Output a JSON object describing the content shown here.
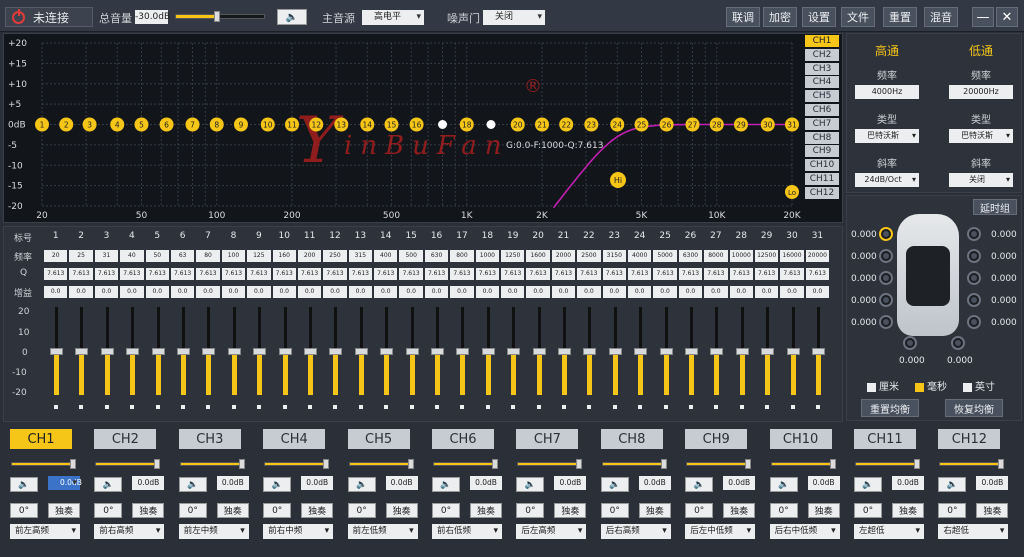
{
  "topbar": {
    "connection_label": "未连接",
    "master_volume_label": "总音量",
    "master_volume_value": "-30.0dB",
    "master_volume_level": 0.45,
    "main_source_label": "主音源",
    "main_source_value": "高电平",
    "noise_gate_label": "噪声门",
    "noise_gate_value": "关闭",
    "buttons": [
      "联调",
      "加密",
      "设置",
      "文件",
      "重置",
      "混音"
    ],
    "minimize": "—",
    "close": "✕"
  },
  "graph": {
    "y_ticks": [
      "+20",
      "+15",
      "+10",
      "+5",
      "0dB",
      "-5",
      "-10",
      "-15",
      "-20"
    ],
    "x_ticks": [
      "20",
      "50",
      "100",
      "200",
      "500",
      "1K",
      "2K",
      "5K",
      "10K",
      "20K"
    ],
    "readout": "G:0.0-F:1000-Q:7.613",
    "logo_text": "inBuFan",
    "logo_mark": "®",
    "hi_marker": "Hi",
    "lo_marker": "Lo",
    "band_points": [
      "1",
      "2",
      "3",
      "4",
      "5",
      "6",
      "7",
      "8",
      "9",
      "10",
      "11",
      "12",
      "13",
      "14",
      "15",
      "16",
      "17",
      "18",
      "19",
      "20",
      "21",
      "22",
      "23",
      "24",
      "25",
      "26",
      "27",
      "28",
      "29",
      "30",
      "31"
    ]
  },
  "channel_list": [
    "CH1",
    "CH2",
    "CH3",
    "CH4",
    "CH5",
    "CH6",
    "CH7",
    "CH8",
    "CH9",
    "CH10",
    "CH11",
    "CH12"
  ],
  "crossover": {
    "high_title": "高通",
    "low_title": "低通",
    "freq_label": "频率",
    "high_freq": "4000Hz",
    "low_freq": "20000Hz",
    "type_label": "类型",
    "high_type": "巴特沃斯",
    "low_type": "巴特沃斯",
    "slope_label": "斜率",
    "high_slope": "24dB/Oct",
    "low_slope": "关闭"
  },
  "delay": {
    "group_button": "延时组",
    "left_values": [
      "0.000",
      "0.000",
      "0.000",
      "0.000",
      "0.000"
    ],
    "right_values": [
      "0.000",
      "0.000",
      "0.000",
      "0.000",
      "0.000"
    ],
    "bottom_values": [
      "0.000",
      "0.000"
    ],
    "units": [
      "厘米",
      "毫秒",
      "英寸"
    ],
    "reset_button": "重置均衡",
    "restore_button": "恢复均衡"
  },
  "eq": {
    "row_labels": [
      "标号",
      "频率",
      "Q",
      "增益"
    ],
    "band_numbers": [
      "1",
      "2",
      "3",
      "4",
      "5",
      "6",
      "7",
      "8",
      "9",
      "10",
      "11",
      "12",
      "13",
      "14",
      "15",
      "16",
      "17",
      "18",
      "19",
      "20",
      "21",
      "22",
      "23",
      "24",
      "25",
      "26",
      "27",
      "28",
      "29",
      "30",
      "31"
    ],
    "frequencies": [
      "20",
      "25",
      "31",
      "40",
      "50",
      "63",
      "80",
      "100",
      "125",
      "160",
      "200",
      "250",
      "315",
      "400",
      "500",
      "630",
      "800",
      "1000",
      "1250",
      "1600",
      "2000",
      "2500",
      "3150",
      "4000",
      "5000",
      "6300",
      "8000",
      "10000",
      "12500",
      "16000",
      "20000"
    ],
    "q_values": [
      "7.613",
      "7.613",
      "7.613",
      "7.613",
      "7.613",
      "7.613",
      "7.613",
      "7.613",
      "7.613",
      "7.613",
      "7.613",
      "7.613",
      "7.613",
      "7.613",
      "7.613",
      "7.613",
      "7.613",
      "7.613",
      "7.613",
      "7.613",
      "7.613",
      "7.613",
      "7.613",
      "7.613",
      "7.613",
      "7.613",
      "7.613",
      "7.613",
      "7.613",
      "7.613",
      "7.613"
    ],
    "gains": [
      "0.0",
      "0.0",
      "0.0",
      "0.0",
      "0.0",
      "0.0",
      "0.0",
      "0.0",
      "0.0",
      "0.0",
      "0.0",
      "0.0",
      "0.0",
      "0.0",
      "0.0",
      "0.0",
      "0.0",
      "0.0",
      "0.0",
      "0.0",
      "0.0",
      "0.0",
      "0.0",
      "0.0",
      "0.0",
      "0.0",
      "0.0",
      "0.0",
      "0.0",
      "0.0",
      "0.0"
    ],
    "slider_scale": [
      "20",
      "10",
      "0",
      "-10",
      "-20"
    ]
  },
  "channels": [
    {
      "name": "CH1",
      "gain": "0.0dB",
      "phase": "0°",
      "solo": "独奏",
      "output": "前左高频"
    },
    {
      "name": "CH2",
      "gain": "0.0dB",
      "phase": "0°",
      "solo": "独奏",
      "output": "前右高频"
    },
    {
      "name": "CH3",
      "gain": "0.0dB",
      "phase": "0°",
      "solo": "独奏",
      "output": "前左中频"
    },
    {
      "name": "CH4",
      "gain": "0.0dB",
      "phase": "0°",
      "solo": "独奏",
      "output": "前右中频"
    },
    {
      "name": "CH5",
      "gain": "0.0dB",
      "phase": "0°",
      "solo": "独奏",
      "output": "前左低频"
    },
    {
      "name": "CH6",
      "gain": "0.0dB",
      "phase": "0°",
      "solo": "独奏",
      "output": "前右低频"
    },
    {
      "name": "CH7",
      "gain": "0.0dB",
      "phase": "0°",
      "solo": "独奏",
      "output": "后左高频"
    },
    {
      "name": "CH8",
      "gain": "0.0dB",
      "phase": "0°",
      "solo": "独奏",
      "output": "后右高频"
    },
    {
      "name": "CH9",
      "gain": "0.0dB",
      "phase": "0°",
      "solo": "独奏",
      "output": "后左中低频"
    },
    {
      "name": "CH10",
      "gain": "0.0dB",
      "phase": "0°",
      "solo": "独奏",
      "output": "后右中低频"
    },
    {
      "name": "CH11",
      "gain": "0.0dB",
      "phase": "0°",
      "solo": "独奏",
      "output": "左超低"
    },
    {
      "name": "CH12",
      "gain": "0.0dB",
      "phase": "0°",
      "solo": "独奏",
      "output": "右超低"
    }
  ],
  "colors": {
    "accent": "#f5c518",
    "curve": "#c21fb3",
    "logo": "#b02020"
  },
  "icons": {
    "speaker": "speaker-icon",
    "power": "power-icon"
  }
}
